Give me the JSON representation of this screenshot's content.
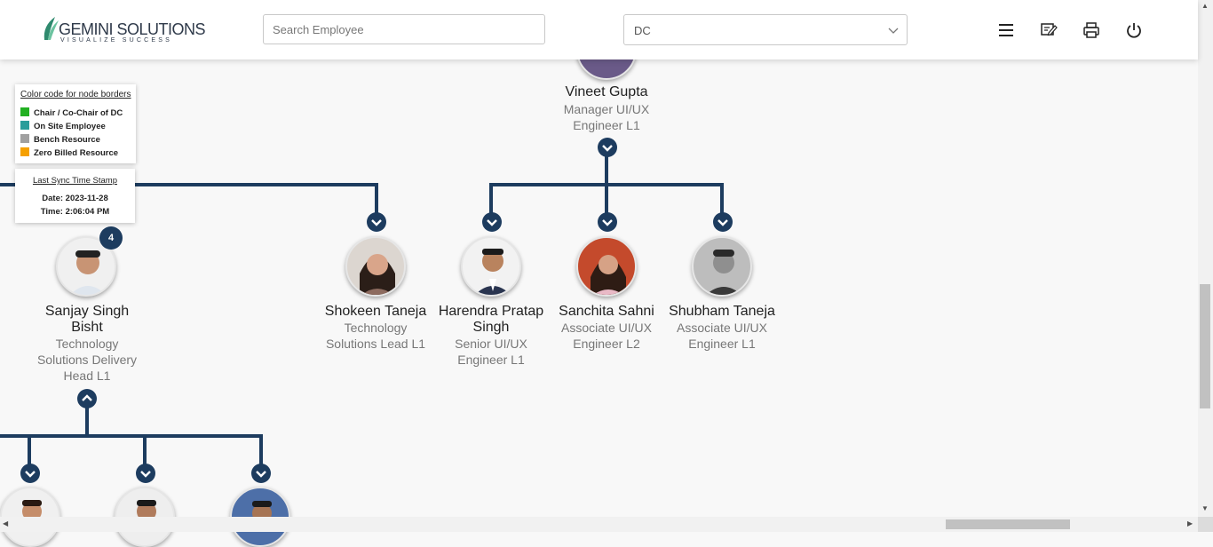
{
  "header": {
    "logo_main": "GEMINI SOLUTIONS",
    "logo_tagline": "VISUALIZE SUCCESS",
    "search_placeholder": "Search Employee",
    "select_value": "DC",
    "icons": [
      "menu-icon",
      "edit-note-icon",
      "print-icon",
      "power-icon"
    ]
  },
  "legend": {
    "title": "Color code for node borders",
    "items": [
      {
        "label": "Chair / Co-Chair of DC",
        "color": "#22b022"
      },
      {
        "label": "On Site Employee",
        "color": "#2a9d9a"
      },
      {
        "label": "Bench Resource",
        "color": "#a0a0a0"
      },
      {
        "label": "Zero Billed Resource",
        "color": "#f5a000"
      }
    ]
  },
  "sync": {
    "title": "Last Sync Time Stamp",
    "date": "Date: 2023-11-28",
    "time": "Time: 2:06:04 PM"
  },
  "tree": {
    "line_color": "#1d3c5f",
    "manager": {
      "name": "Vineet Gupta",
      "role_lines": [
        "Manager UI/UX",
        "Engineer L1"
      ]
    },
    "sanjay": {
      "name_lines": [
        "Sanjay Singh",
        "Bisht"
      ],
      "role_lines": [
        "Technology",
        "Solutions Delivery",
        "Head L1"
      ],
      "badge": "4"
    },
    "shokeen": {
      "name": "Shokeen Taneja",
      "role_lines": [
        "Technology",
        "Solutions Lead L1"
      ]
    },
    "harendra": {
      "name_lines": [
        "Harendra Pratap",
        "Singh"
      ],
      "role_lines": [
        "Senior UI/UX",
        "Engineer L1"
      ]
    },
    "sanchita": {
      "name": "Sanchita Sahni",
      "role_lines": [
        "Associate UI/UX",
        "Engineer L2"
      ]
    },
    "shubham": {
      "name": "Shubham Taneja",
      "role_lines": [
        "Associate UI/UX",
        "Engineer L1"
      ]
    }
  }
}
